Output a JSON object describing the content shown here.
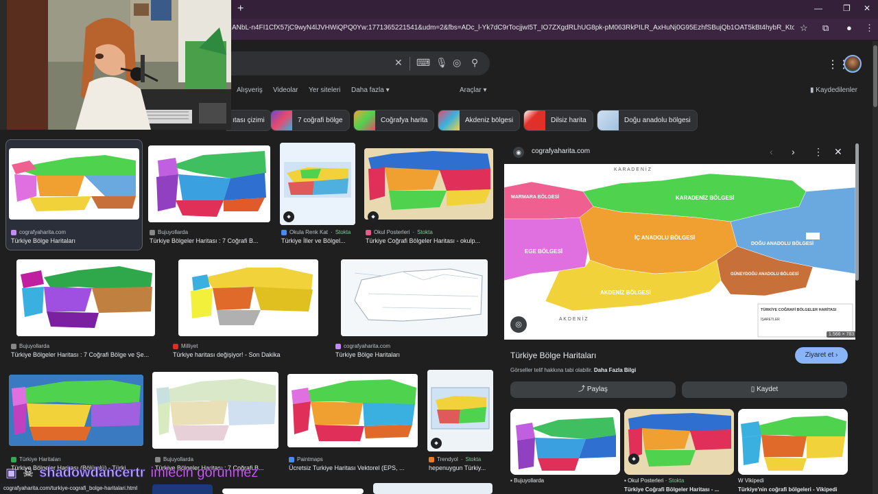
{
  "browser": {
    "url": "ANbL-n4FI1CfX57jC9wyN4lJVHWiQPQ0Yw:1771365221541&udm=2&fbs=ADc_l-Yk7dC9rTocjjwI5T_IO7ZXgdRLhUG8pk-pM063RkPILR_AxHuNj0G95EzhfSBujQb1OAT5kBt4hybR_Kto9RDKpvJ1mHCPa5...",
    "new_tab_icon": "plus-icon",
    "window_controls": [
      "minimize-icon",
      "restore-icon",
      "close-icon"
    ]
  },
  "search": {
    "clear_icon": "close-icon",
    "keyboard_icon": "keyboard-icon",
    "mic_icon": "mic-icon",
    "lens_icon": "lens-icon",
    "search_icon": "search-icon"
  },
  "nav": {
    "tabs": [
      "Alışveriş",
      "Videolar",
      "Yer siteleri",
      "Daha fazla"
    ],
    "tools": "Araçlar",
    "saved": "Kaydedilenler"
  },
  "chips": [
    {
      "label": "ıtası çizimi",
      "color": "#d97a3a"
    },
    {
      "label": "7 coğrafi bölge",
      "color": "#6a4bd1"
    },
    {
      "label": "Coğrafya harita",
      "color": "#f2a43a"
    },
    {
      "label": "Akdeniz bölgesi",
      "color": "#e84a6a"
    },
    {
      "label": "Dilsiz harita",
      "color": "#e0302a"
    },
    {
      "label": "Doğu anadolu bölgesi",
      "color": "#cfe0ef"
    }
  ],
  "results": [
    {
      "source": "cografyaharita.com",
      "title": "Türkiye Bölge Haritaları",
      "fav": "#c58af9"
    },
    {
      "source": "Bujuyollarda",
      "title": "Türkiye Bölgeler Haritası : 7 Coğrafi B...",
      "fav": "#888888"
    },
    {
      "source": "Okula Renk Kat",
      "stock": "Stokta",
      "title": "Türkiye İller ve Bölgel...",
      "fav": "#4a8af4"
    },
    {
      "source": "Okul Posterleri",
      "stock": "Stokta",
      "title": "Türkiye Coğrafi Bölgeler Haritası - okulp...",
      "fav": "#e85a8a"
    },
    {
      "source": "Bujuyollarda",
      "title": "Türkiye Bölgeler Haritası : 7 Coğrafi Bölge ve Şe...",
      "fav": "#888888"
    },
    {
      "source": "Milliyet",
      "title": "Türkiye haritası değişiyor! - Son Dakika",
      "fav": "#d93025"
    },
    {
      "source": "cografyaharita.com",
      "title": "Türkiye Bölge Haritaları",
      "fav": "#c58af9"
    },
    {
      "source": "Türkiye Haritaları",
      "title": "Türkiye Bölgeler Haritası (Bölümlü) - Türki...",
      "fav": "#34a853"
    },
    {
      "source": "Bujuyollarda",
      "title": "Türkiye Bölgeler Haritası : 7 Coğrafi B...",
      "fav": "#888888"
    },
    {
      "source": "Paintmaps",
      "title": "Ücretsiz Turkiye Haritası Vektorel (EPS, ...",
      "fav": "#4a8af4"
    },
    {
      "source": "Trendyol",
      "stock": "Stokta",
      "title": "hepenuygun Türkiy...",
      "fav": "#f27a1a"
    }
  ],
  "panel": {
    "domain": "cografyaharita.com",
    "dimensions": "1.566 × 783",
    "title": "Türkiye Bölge Haritaları",
    "visit": "Ziyaret et",
    "copyright": "Görseller telif hakkına tabi olabilir.",
    "more_info": "Daha Fazla Bilgi",
    "share": "Paylaş",
    "save": "Kaydet",
    "map": {
      "north": "K A R A D E N İ Z",
      "south": "A K D E N İ Z",
      "legend_title": "TÜRKİYE COĞRAFİ BÖLGELER HARİTASI",
      "legend_sub": "İŞARETLER",
      "regions": [
        "MARMARA BÖLGESİ",
        "KARADENİZ BÖLGESİ",
        "İÇ ANADOLU BÖLGESİ",
        "EGE BÖLGESİ",
        "AKDENİZ BÖLGESİ",
        "DOĞU ANADOLU BÖLGESİ",
        "GÜNEYDOĞU ANADOLU BÖLGESİ"
      ]
    },
    "related": [
      {
        "source": "Bujuyollarda",
        "title": ""
      },
      {
        "source": "Okul Posterleri",
        "stock": "Stokta",
        "title": "Türkiye Coğrafi Bölgeler Haritası - ..."
      },
      {
        "source": "Vikipedi",
        "title": "Türkiye'nin coğrafi bölgeleri - Vikipedi"
      }
    ]
  },
  "status_url": "cografyaharita.com/turkiye-cografi_bolge-haritalari.html",
  "overlay": {
    "username": "shadowdancertr",
    "message": "imlecin görünmez"
  },
  "colors": {
    "marmara": "#ef5f8f",
    "karadeniz": "#4fd34f",
    "ic_anadolu": "#f0a030",
    "ege": "#e070e0",
    "akdeniz": "#f2d23a",
    "dogu": "#6aa8e0",
    "guneydogu": "#c8703a",
    "accent": "#8ab4f8"
  }
}
